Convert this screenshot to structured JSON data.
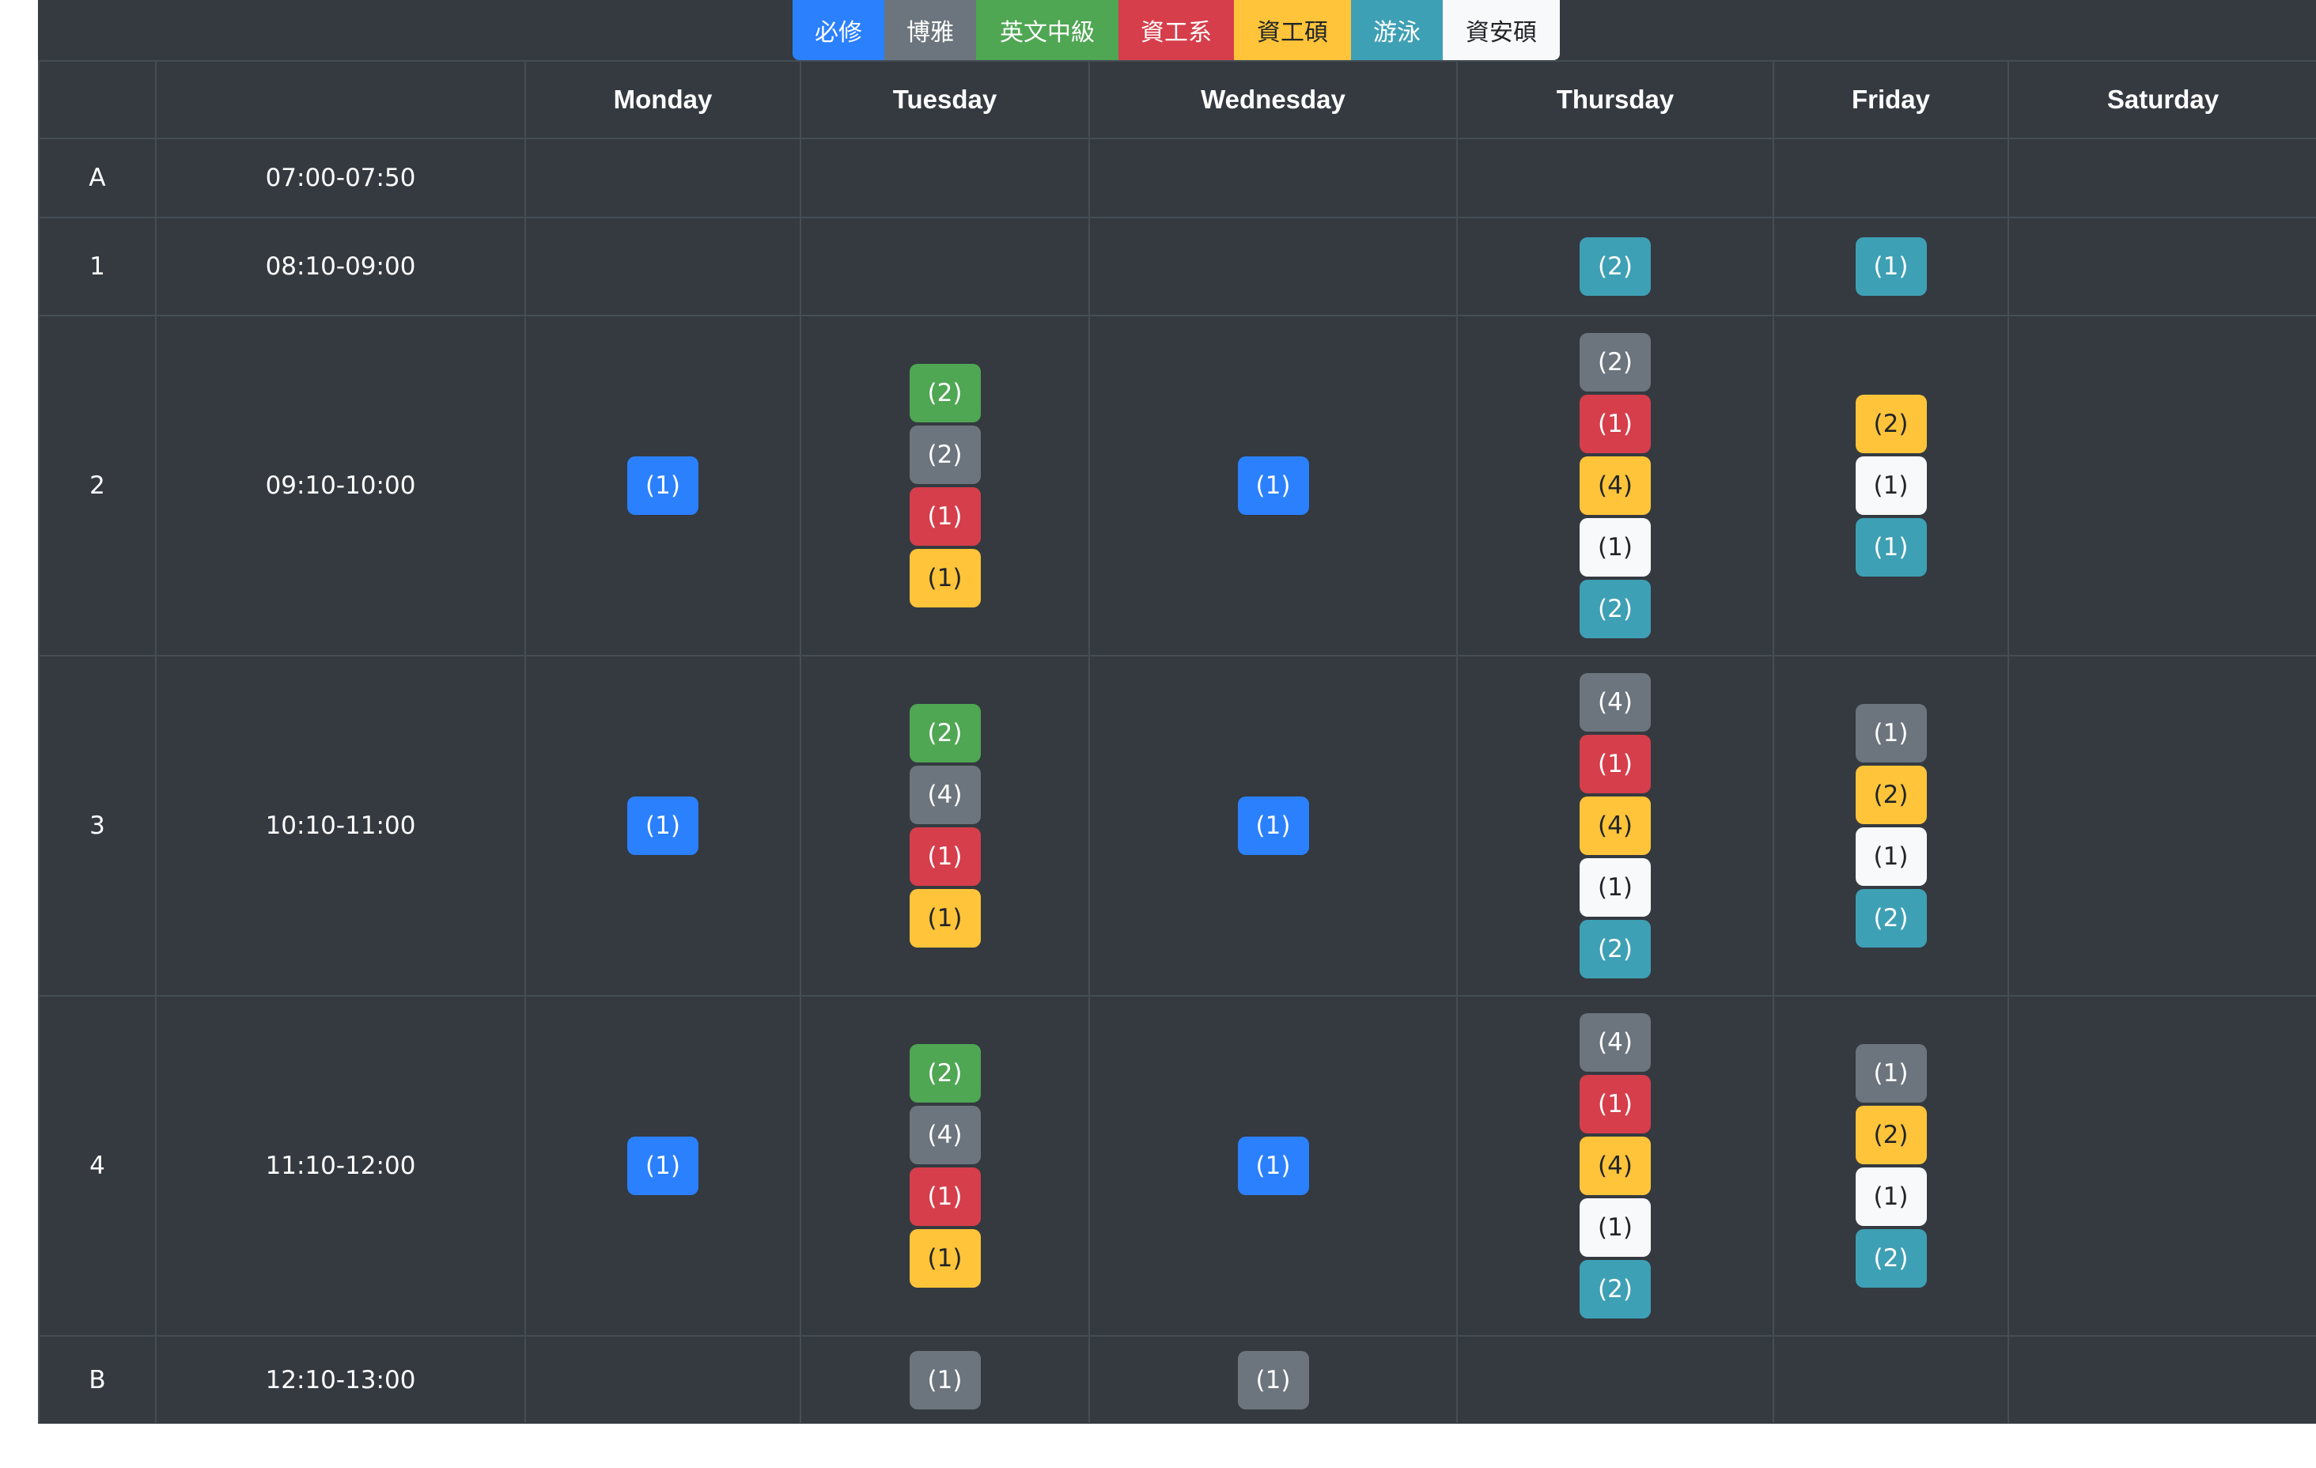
{
  "legend": [
    {
      "label": "必修",
      "bg": "#2b80fd",
      "fg": "#ffffff",
      "w": 116
    },
    {
      "label": "博雅",
      "bg": "#6c757d",
      "fg": "#ffffff",
      "w": 116
    },
    {
      "label": "英文中級",
      "bg": "#4fa653",
      "fg": "#ffffff",
      "w": 180
    },
    {
      "label": "資工系",
      "bg": "#d63e4b",
      "fg": "#ffffff",
      "w": 146
    },
    {
      "label": "資工碩",
      "bg": "#ffc439",
      "fg": "#212529",
      "w": 148
    },
    {
      "label": "游泳",
      "bg": "#3ea0b5",
      "fg": "#ffffff",
      "w": 116
    },
    {
      "label": "資安碩",
      "bg": "#f8f9fa",
      "fg": "#212529",
      "w": 148
    }
  ],
  "colors": {
    "required": "#2b80fd",
    "general": "#6c757d",
    "english": "#4fa653",
    "cs": "#d63e4b",
    "csm": "#ffc439",
    "swim": "#3ea0b5",
    "sec": "#f8f9fa"
  },
  "days": [
    "Monday",
    "Tuesday",
    "Wednesday",
    "Thursday",
    "Friday",
    "Saturday"
  ],
  "periods": [
    {
      "id": "A",
      "time": "07:00-07:50",
      "cells": [
        [],
        [],
        [],
        [],
        [],
        []
      ]
    },
    {
      "id": "1",
      "time": "08:10-09:00",
      "cells": [
        [],
        [],
        [],
        [
          [
            "swim",
            "(2)"
          ]
        ],
        [
          [
            "swim",
            "(1)"
          ]
        ],
        []
      ]
    },
    {
      "id": "2",
      "time": "09:10-10:00",
      "cells": [
        [
          [
            "required",
            "(1)"
          ]
        ],
        [
          [
            "english",
            "(2)"
          ],
          [
            "general",
            "(2)"
          ],
          [
            "cs",
            "(1)"
          ],
          [
            "csm",
            "(1)"
          ]
        ],
        [
          [
            "required",
            "(1)"
          ]
        ],
        [
          [
            "general",
            "(2)"
          ],
          [
            "cs",
            "(1)"
          ],
          [
            "csm",
            "(4)"
          ],
          [
            "sec",
            "(1)"
          ],
          [
            "swim",
            "(2)"
          ]
        ],
        [
          [
            "csm",
            "(2)"
          ],
          [
            "sec",
            "(1)"
          ],
          [
            "swim",
            "(1)"
          ]
        ],
        []
      ]
    },
    {
      "id": "3",
      "time": "10:10-11:00",
      "cells": [
        [
          [
            "required",
            "(1)"
          ]
        ],
        [
          [
            "english",
            "(2)"
          ],
          [
            "general",
            "(4)"
          ],
          [
            "cs",
            "(1)"
          ],
          [
            "csm",
            "(1)"
          ]
        ],
        [
          [
            "required",
            "(1)"
          ]
        ],
        [
          [
            "general",
            "(4)"
          ],
          [
            "cs",
            "(1)"
          ],
          [
            "csm",
            "(4)"
          ],
          [
            "sec",
            "(1)"
          ],
          [
            "swim",
            "(2)"
          ]
        ],
        [
          [
            "general",
            "(1)"
          ],
          [
            "csm",
            "(2)"
          ],
          [
            "sec",
            "(1)"
          ],
          [
            "swim",
            "(2)"
          ]
        ],
        []
      ]
    },
    {
      "id": "4",
      "time": "11:10-12:00",
      "cells": [
        [
          [
            "required",
            "(1)"
          ]
        ],
        [
          [
            "english",
            "(2)"
          ],
          [
            "general",
            "(4)"
          ],
          [
            "cs",
            "(1)"
          ],
          [
            "csm",
            "(1)"
          ]
        ],
        [
          [
            "required",
            "(1)"
          ]
        ],
        [
          [
            "general",
            "(4)"
          ],
          [
            "cs",
            "(1)"
          ],
          [
            "csm",
            "(4)"
          ],
          [
            "sec",
            "(1)"
          ],
          [
            "swim",
            "(2)"
          ]
        ],
        [
          [
            "general",
            "(1)"
          ],
          [
            "csm",
            "(2)"
          ],
          [
            "sec",
            "(1)"
          ],
          [
            "swim",
            "(2)"
          ]
        ],
        []
      ]
    },
    {
      "id": "B",
      "time": "12:10-13:00",
      "cells": [
        [],
        [
          [
            "general",
            "(1)"
          ]
        ],
        [
          [
            "general",
            "(1)"
          ]
        ],
        [],
        [],
        []
      ]
    }
  ]
}
